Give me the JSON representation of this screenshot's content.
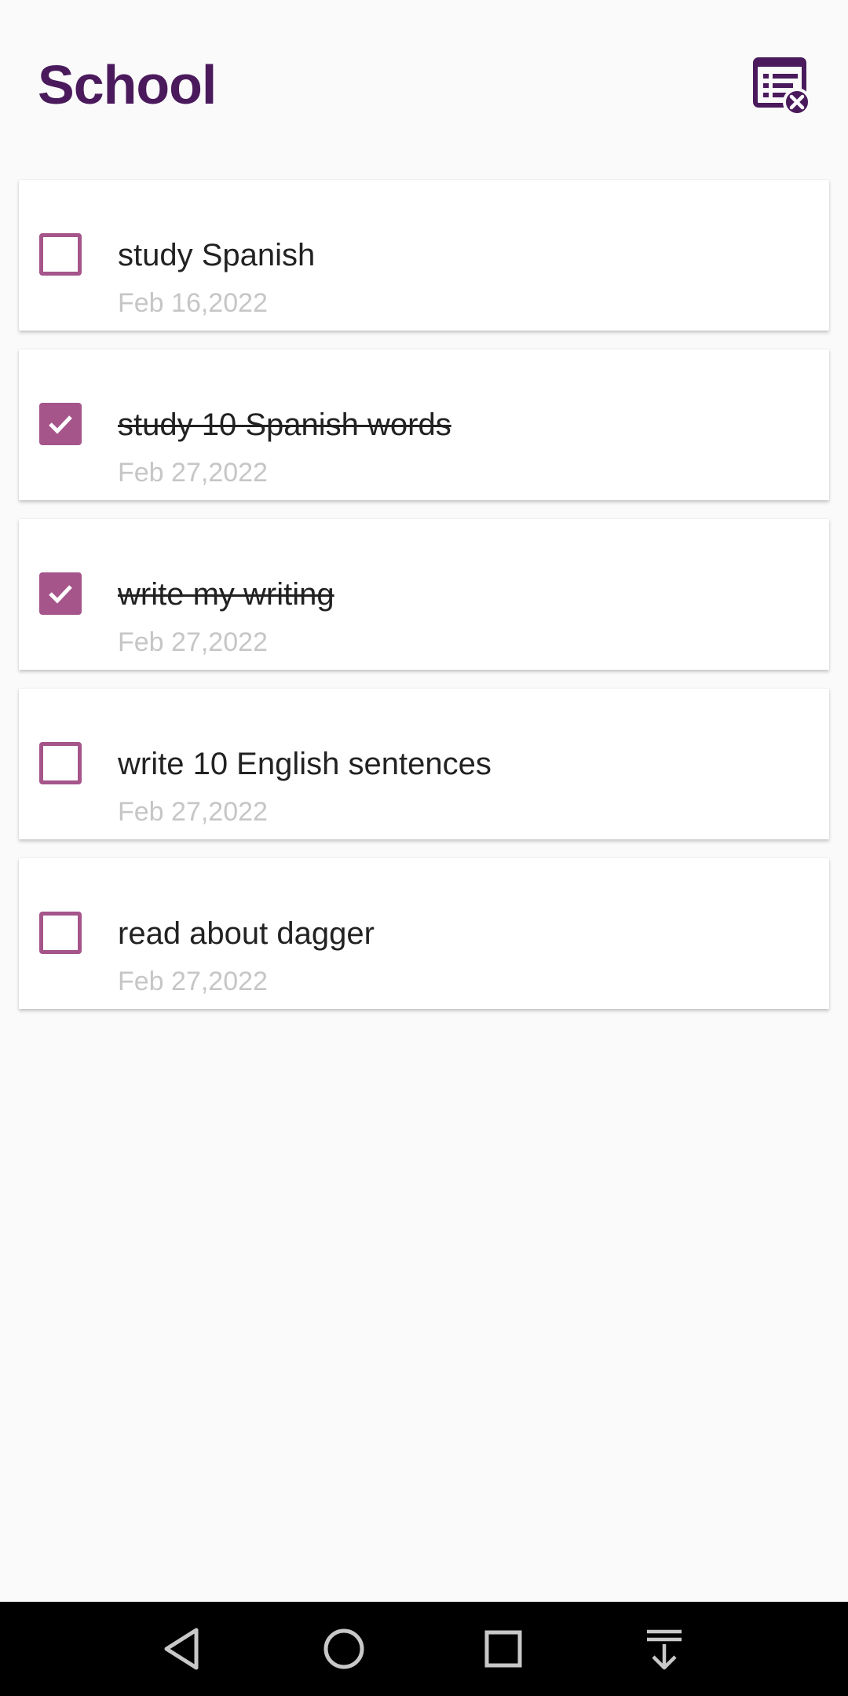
{
  "header": {
    "title": "School"
  },
  "tasks": [
    {
      "label": "study Spanish",
      "date": "Feb 16,2022",
      "done": false
    },
    {
      "label": "study 10 Spanish words",
      "date": "Feb 27,2022",
      "done": true
    },
    {
      "label": "write my writing",
      "date": "Feb 27,2022",
      "done": true
    },
    {
      "label": "write 10 English sentences",
      "date": "Feb 27,2022",
      "done": false
    },
    {
      "label": "read about dagger",
      "date": "Feb 27,2022",
      "done": false
    }
  ],
  "colors": {
    "title": "#4a1a5c",
    "accent": "#a5558a",
    "date": "#c6c6c6",
    "background": "#fafafa",
    "navbar": "#000000"
  },
  "icons": {
    "clear_completed": "clear-list-icon",
    "nav_back": "back-triangle-icon",
    "nav_home": "home-circle-icon",
    "nav_recents": "recents-square-icon",
    "nav_notifications": "pull-down-icon"
  }
}
